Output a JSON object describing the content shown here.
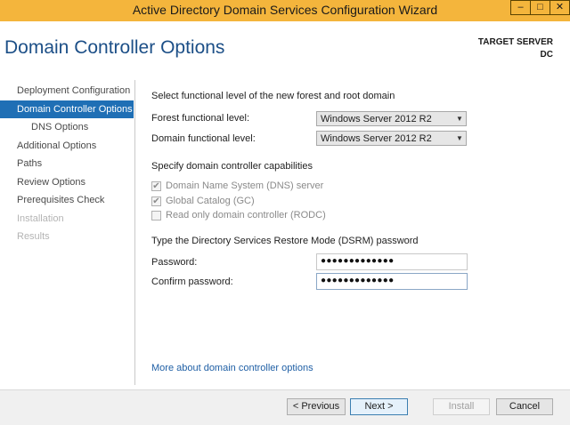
{
  "window": {
    "title": "Active Directory Domain Services Configuration Wizard",
    "min_glyph": "–",
    "max_glyph": "□",
    "close_glyph": "✕"
  },
  "header": {
    "page_title": "Domain Controller Options",
    "target_label": "TARGET SERVER",
    "target_value": "DC"
  },
  "nav": {
    "items": [
      {
        "label": "Deployment Configuration"
      },
      {
        "label": "Domain Controller Options"
      },
      {
        "label": "DNS Options"
      },
      {
        "label": "Additional Options"
      },
      {
        "label": "Paths"
      },
      {
        "label": "Review Options"
      },
      {
        "label": "Prerequisites Check"
      },
      {
        "label": "Installation"
      },
      {
        "label": "Results"
      }
    ]
  },
  "functional_level": {
    "heading": "Select functional level of the new forest and root domain",
    "forest_label": "Forest functional level:",
    "forest_value": "Windows Server 2012 R2",
    "domain_label": "Domain functional level:",
    "domain_value": "Windows Server 2012 R2"
  },
  "capabilities": {
    "heading": "Specify domain controller capabilities",
    "dns_label": "Domain Name System (DNS) server",
    "gc_label": "Global Catalog (GC)",
    "rodc_label": "Read only domain controller (RODC)",
    "check_glyph": "✔"
  },
  "dsrm": {
    "heading": "Type the Directory Services Restore Mode (DSRM) password",
    "password_label": "Password:",
    "password_value": "●●●●●●●●●●●●●",
    "confirm_label": "Confirm password:",
    "confirm_value": "●●●●●●●●●●●●●"
  },
  "more_link": "More about domain controller options",
  "buttons": {
    "previous": "< Previous",
    "next": "Next >",
    "install": "Install",
    "cancel": "Cancel"
  },
  "colors": {
    "titlebar": "#f4b53c",
    "accent": "#1f6fb5",
    "heading": "#1c4f87"
  }
}
